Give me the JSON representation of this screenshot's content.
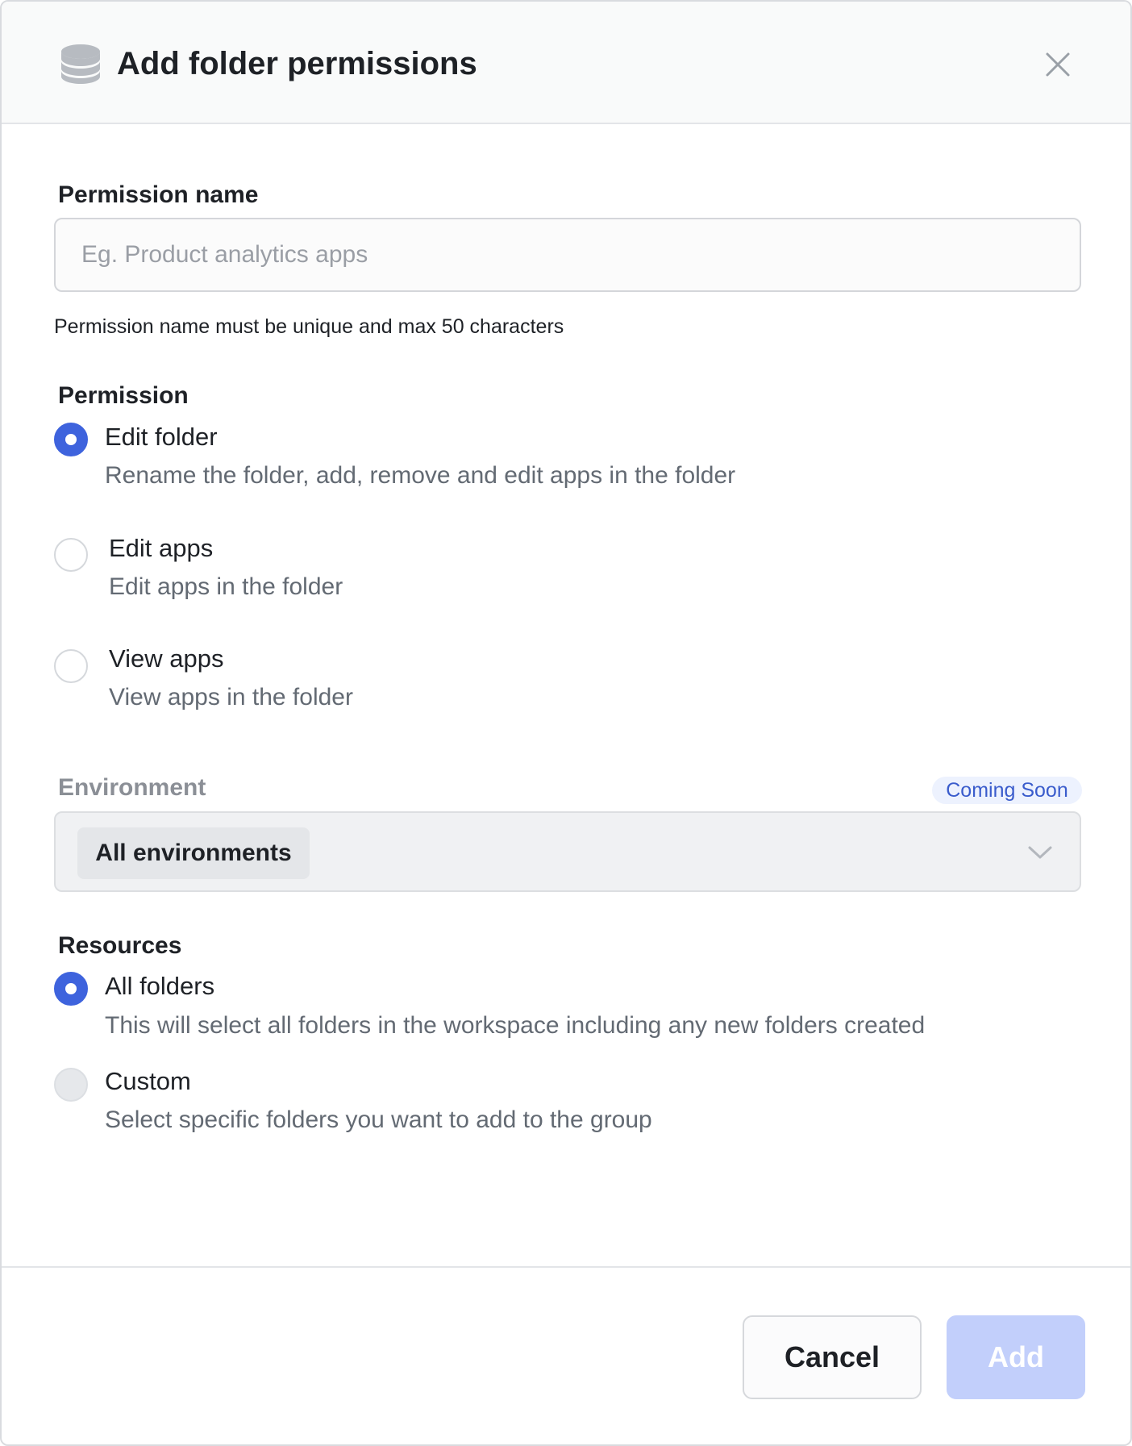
{
  "header": {
    "title": "Add folder permissions",
    "icon": "database-icon",
    "close_icon": "close-icon"
  },
  "permission_name": {
    "label": "Permission name",
    "value": "",
    "placeholder": "Eg. Product analytics apps",
    "helper": "Permission name must be unique and max 50 characters"
  },
  "permission": {
    "label": "Permission",
    "options": [
      {
        "title": "Edit folder",
        "description": "Rename the folder, add, remove and edit apps in the folder",
        "checked": true
      },
      {
        "title": "Edit apps",
        "description": "Edit apps in the folder",
        "checked": false
      },
      {
        "title": "View apps",
        "description": "View apps in the folder",
        "checked": false
      }
    ]
  },
  "environment": {
    "label": "Environment",
    "badge": "Coming Soon",
    "selected": "All environments"
  },
  "resources": {
    "label": "Resources",
    "options": [
      {
        "title": "All folders",
        "description": "This will select all folders in the workspace including any new folders created",
        "checked": true
      },
      {
        "title": "Custom",
        "description": "Select specific folders you want to add to the group",
        "checked": false,
        "disabled": true
      }
    ]
  },
  "footer": {
    "cancel_label": "Cancel",
    "add_label": "Add"
  },
  "colors": {
    "accent": "#3e63dd",
    "add_button_disabled": "#c2cffb",
    "badge_bg": "#edf2fe",
    "badge_text": "#3a5ccc"
  }
}
